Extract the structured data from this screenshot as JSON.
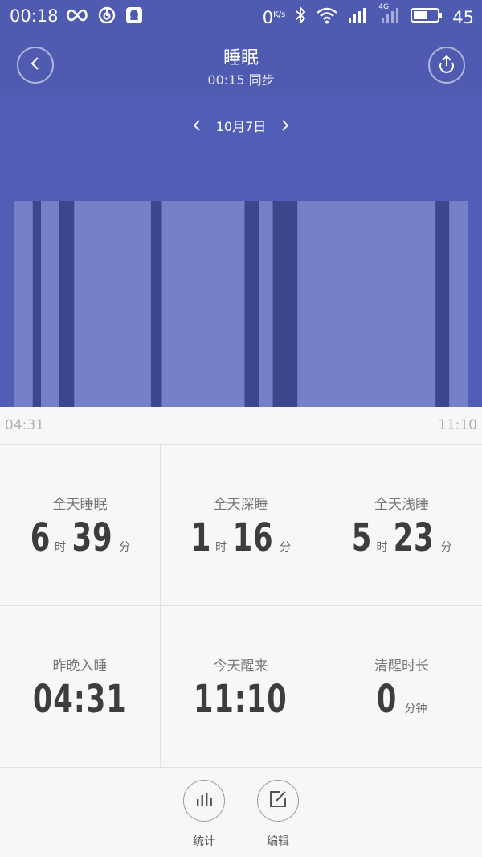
{
  "status_bar": {
    "time": "00:18",
    "net_speed_value": "0",
    "net_speed_unit": "K/s",
    "network_label": "4G",
    "battery_level": "45",
    "icons": [
      "infinity-icon",
      "netease-music-icon",
      "qq-icon",
      "bluetooth-icon",
      "wifi-icon",
      "signal-icon",
      "signal-4g-icon",
      "battery-icon"
    ]
  },
  "header": {
    "title": "睡眠",
    "sync_text": "00:15 同步"
  },
  "date_nav": {
    "date": "10月7日"
  },
  "chart_data": {
    "type": "bar",
    "title": "",
    "start_time": "04:31",
    "end_time": "11:10",
    "stage_colors": {
      "light": "#7680c8",
      "deep": "#3d458d"
    },
    "segments": [
      {
        "stage": "light",
        "start": 0.0,
        "end": 0.042
      },
      {
        "stage": "deep",
        "start": 0.042,
        "end": 0.06
      },
      {
        "stage": "light",
        "start": 0.06,
        "end": 0.1
      },
      {
        "stage": "deep",
        "start": 0.1,
        "end": 0.133
      },
      {
        "stage": "light",
        "start": 0.133,
        "end": 0.302
      },
      {
        "stage": "deep",
        "start": 0.302,
        "end": 0.326
      },
      {
        "stage": "light",
        "start": 0.326,
        "end": 0.508
      },
      {
        "stage": "deep",
        "start": 0.508,
        "end": 0.54
      },
      {
        "stage": "light",
        "start": 0.54,
        "end": 0.57
      },
      {
        "stage": "deep",
        "start": 0.57,
        "end": 0.624
      },
      {
        "stage": "light",
        "start": 0.624,
        "end": 0.928
      },
      {
        "stage": "deep",
        "start": 0.928,
        "end": 0.958
      },
      {
        "stage": "light",
        "start": 0.958,
        "end": 1.0
      }
    ]
  },
  "stats": {
    "total_sleep": {
      "label": "全天睡眠",
      "hours": "6",
      "hours_unit": "时",
      "minutes": "39",
      "minutes_unit": "分"
    },
    "deep_sleep": {
      "label": "全天深睡",
      "hours": "1",
      "hours_unit": "时",
      "minutes": "16",
      "minutes_unit": "分"
    },
    "light_sleep": {
      "label": "全天浅睡",
      "hours": "5",
      "hours_unit": "时",
      "minutes": "23",
      "minutes_unit": "分"
    },
    "fell_asleep": {
      "label": "昨晚入睡",
      "value": "04:31"
    },
    "woke_up": {
      "label": "今天醒来",
      "value": "11:10"
    },
    "awake_duration": {
      "label": "清醒时长",
      "value": "0",
      "unit": "分钟"
    }
  },
  "actions": {
    "stats_label": "统计",
    "edit_label": "编辑"
  },
  "colors": {
    "header_bg": "#4f5bb0",
    "chart_bg": "#505eb8",
    "page_bg": "#f7f7f7"
  }
}
